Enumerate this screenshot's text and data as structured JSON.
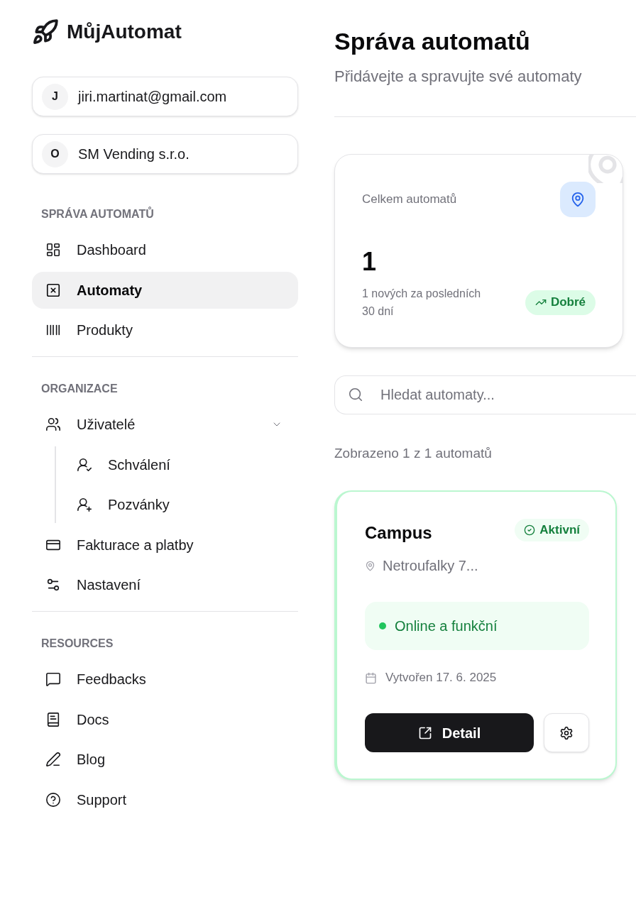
{
  "sidebar": {
    "app_name": "MůjAutomat",
    "accounts": [
      {
        "initial": "J",
        "label": "jiri.martinat@gmail.com"
      },
      {
        "initial": "O",
        "label": "SM Vending s.r.o."
      }
    ],
    "sections": [
      {
        "heading": "SPRÁVA AUTOMATŮ",
        "items": [
          {
            "label": "Dashboard",
            "selected": false
          },
          {
            "label": "Automaty",
            "selected": true
          },
          {
            "label": "Produkty",
            "selected": false
          }
        ]
      },
      {
        "heading": "ORGANIZACE",
        "items": [
          {
            "label": "Uživatelé",
            "selected": false,
            "expanded": true,
            "children": [
              {
                "label": "Schválení",
                "selected": false
              },
              {
                "label": "Pozvánky",
                "selected": false
              }
            ]
          },
          {
            "label": "Fakturace a platby",
            "selected": false
          },
          {
            "label": "Nastavení",
            "selected": false
          }
        ]
      },
      {
        "heading": "RESOURCES",
        "items": [
          {
            "label": "Feedbacks",
            "selected": false
          },
          {
            "label": "Docs",
            "selected": false
          },
          {
            "label": "Blog",
            "selected": false
          },
          {
            "label": "Support",
            "selected": false
          }
        ]
      }
    ]
  },
  "header": {
    "title": "Správa automatů",
    "subtitle": "Přidávejte a spravujte své automaty"
  },
  "stat_card": {
    "label": "Celkem automatů",
    "value": "1",
    "note": "1 nových za posledních 30 dní",
    "badge": "Dobré"
  },
  "search": {
    "placeholder": "Hledat automaty..."
  },
  "result_count": "Zobrazeno 1 z 1 automatů",
  "machines": [
    {
      "name": "Campus",
      "status": "Aktivní",
      "address": "Netroufalky 7...",
      "health": "Online a funkční",
      "created": "Vytvořen 17. 6. 2025",
      "detail_button": "Detail"
    }
  ]
}
